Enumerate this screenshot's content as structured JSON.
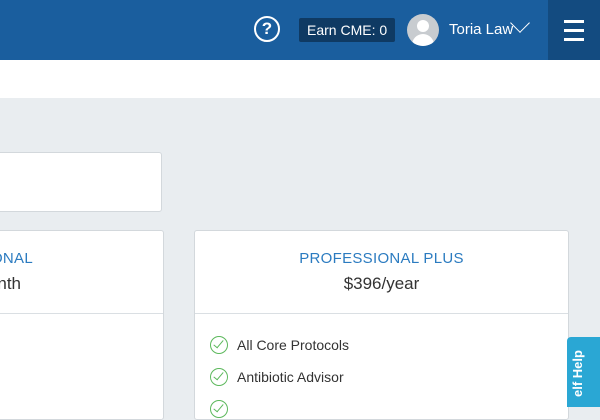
{
  "header": {
    "help_icon": "question-circle-icon",
    "cme_label": "Earn CME: 0",
    "user_name": "Toria Law",
    "avatar_icon": "user-avatar-icon",
    "menu_icon": "hamburger-menu-icon"
  },
  "plans": [
    {
      "name": "ONAL",
      "price": "nth"
    },
    {
      "name": "PROFESSIONAL PLUS",
      "price": "$396/year",
      "features": [
        "All Core Protocols",
        "Antibiotic Advisor"
      ]
    }
  ],
  "self_help": {
    "label": "elf Help"
  },
  "colors": {
    "header_bg": "#1a5e9e",
    "accent": "#2b7bc0",
    "check": "#5cb85c",
    "self_help_bg": "#2aa7d4"
  }
}
